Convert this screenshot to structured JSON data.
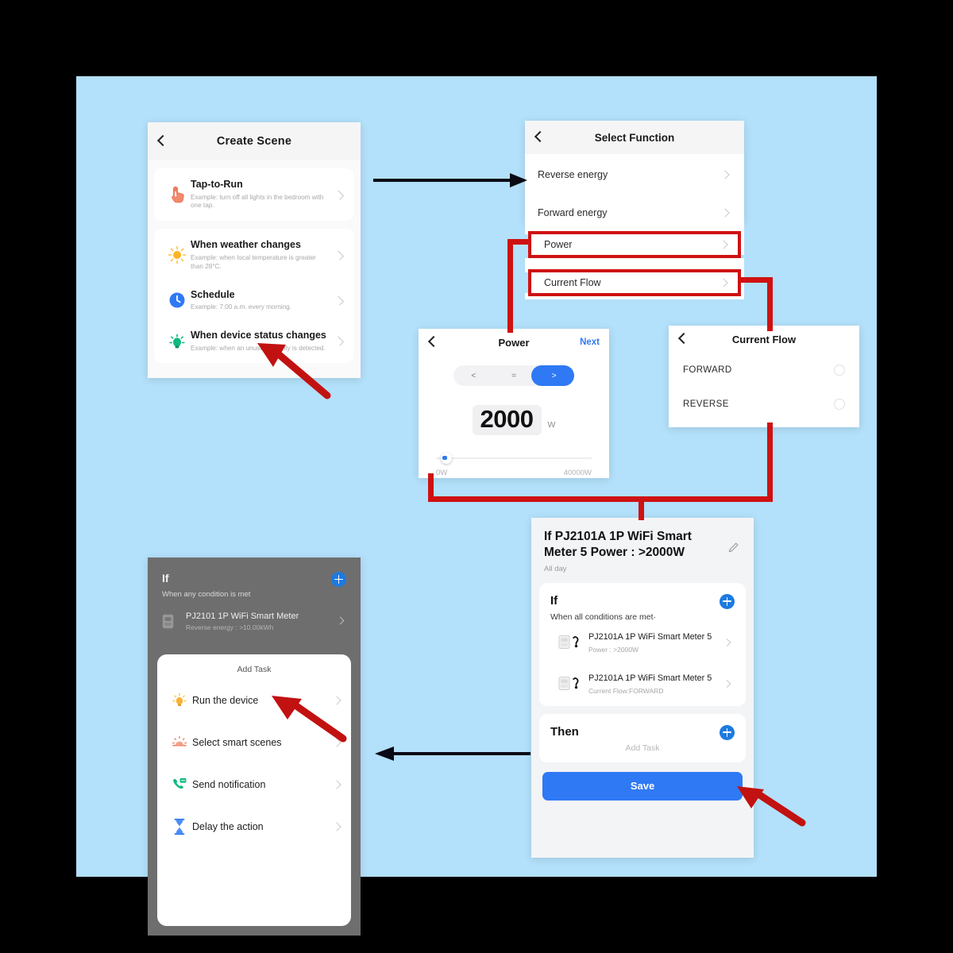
{
  "theme": {
    "background": "#b3e0fa",
    "accent_blue": "#2f79f5",
    "highlight_red": "#cf1111",
    "arrow_black": "#0a0a14"
  },
  "create_scene": {
    "title": "Create Scene",
    "back_icon": "chevron-left-icon",
    "items": [
      {
        "icon": "tap-hand-icon",
        "name": "Tap-to-Run",
        "desc": "Example: turn off all lights in the bedroom with one tap."
      },
      {
        "icon": "sun-icon",
        "name": "When weather changes",
        "desc": "Example: when local temperature is greater than 28°C."
      },
      {
        "icon": "clock-icon",
        "name": "Schedule",
        "desc": "Example: 7:00 a.m. every morning."
      },
      {
        "icon": "motion-sensor-icon",
        "name": "When device status changes",
        "desc": "Example: when an unusual activity is detected."
      }
    ]
  },
  "select_function": {
    "title": "Select Function",
    "back_icon": "chevron-left-icon",
    "items": [
      {
        "label": "Reverse energy",
        "highlighted": false
      },
      {
        "label": "Forward energy",
        "highlighted": false
      },
      {
        "label": "Power",
        "highlighted": true
      },
      {
        "label": "Current Flow",
        "highlighted": true
      }
    ]
  },
  "power_panel": {
    "title": "Power",
    "back_icon": "chevron-left-icon",
    "next_label": "Next",
    "operators": [
      "<",
      "=",
      ">"
    ],
    "selected_operator": ">",
    "value": "2000",
    "unit": "W",
    "slider_min_label": "0W",
    "slider_max_label": "40000W",
    "slider_percent": 5
  },
  "current_flow_panel": {
    "title": "Current Flow",
    "back_icon": "chevron-left-icon",
    "options": [
      {
        "label": "FORWARD",
        "selected": false
      },
      {
        "label": "REVERSE",
        "selected": false
      }
    ]
  },
  "summary": {
    "heading": "If PJ2101A 1P WiFi Smart Meter  5 Power : >2000W",
    "subheading": "All day",
    "edit_icon": "pencil-icon",
    "if_label": "If",
    "if_plus_icon": "plus-circle-icon",
    "if_condition_text": "When all conditions are met·",
    "conditions": [
      {
        "icon": "smart-meter-icon",
        "name": "PJ2101A 1P WiFi Smart Meter 5",
        "detail": "Power : >2000W"
      },
      {
        "icon": "smart-meter-icon",
        "name": "PJ2101A 1P WiFi Smart Meter 5",
        "detail": "Current Flow:FORWARD"
      }
    ],
    "then_label": "Then",
    "then_plus_icon": "plus-circle-icon",
    "add_task_placeholder": "Add Task",
    "save_label": "Save"
  },
  "add_task": {
    "if_label": "If",
    "if_condition_text": "When any condition is met",
    "if_plus_icon": "plus-circle-icon",
    "background_device": {
      "icon": "smart-meter-icon",
      "name": "PJ2101 1P WiFi Smart Meter",
      "detail": "Reverse energy : >10.00kWh"
    },
    "sheet_title": "Add Task",
    "items": [
      {
        "icon": "bulb-icon",
        "label": "Run the device"
      },
      {
        "icon": "scene-icon",
        "label": "Select smart scenes"
      },
      {
        "icon": "phone-message-icon",
        "label": "Send notification"
      },
      {
        "icon": "hourglass-icon",
        "label": "Delay the action"
      }
    ]
  },
  "annotations": {
    "arrow_create_to_select": "black-arrow-right",
    "arrow_summary_to_addtask": "black-arrow-left",
    "pointer_device_status": "red-pointer-arrow",
    "pointer_run_device": "red-pointer-arrow",
    "pointer_then_plus": "red-pointer-arrow"
  }
}
